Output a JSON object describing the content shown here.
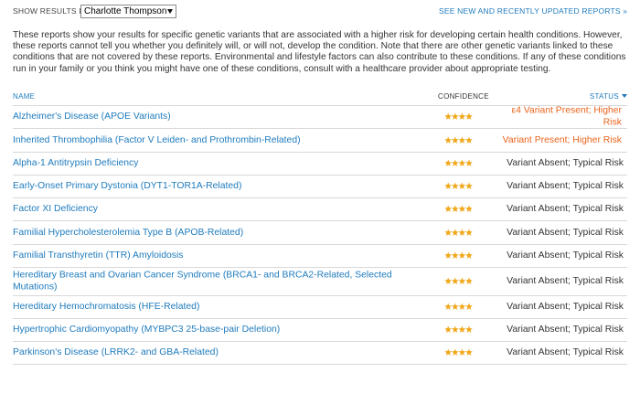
{
  "header": {
    "show_results_label": "SHOW RESULTS FOR",
    "selected_person": "Charlotte Thompson",
    "see_new_link": "SEE NEW AND RECENTLY UPDATED REPORTS",
    "see_new_arrow": "»"
  },
  "intro_text": "These reports show your results for specific genetic variants that are associated with a higher risk for developing certain health conditions. However, these reports cannot tell you whether you definitely will, or will not, develop the condition. Note that there are other genetic variants linked to these conditions that are not covered by these reports. Environmental and lifestyle factors can also contribute to these conditions. If any of these conditions run in your family or you think you might have one of these conditions, consult with a healthcare provider about appropriate testing.",
  "columns": {
    "name": "NAME",
    "confidence": "CONFIDENCE",
    "status": "STATUS"
  },
  "colors": {
    "link": "#1f7bbd",
    "risk": "#e8641c",
    "star": "#f0a81c"
  },
  "rows": [
    {
      "name": "Alzheimer's Disease (APOE Variants)",
      "stars": 4,
      "status": "ε4 Variant Present; Higher Risk",
      "risk": true
    },
    {
      "name": "Inherited Thrombophilia (Factor V Leiden- and Prothrombin-Related)",
      "stars": 4,
      "status": "Variant Present; Higher Risk",
      "risk": true
    },
    {
      "name": "Alpha-1 Antitrypsin Deficiency",
      "stars": 4,
      "status": "Variant Absent; Typical Risk",
      "risk": false
    },
    {
      "name": "Early-Onset Primary Dystonia (DYT1-TOR1A-Related)",
      "stars": 4,
      "status": "Variant Absent; Typical Risk",
      "risk": false
    },
    {
      "name": "Factor XI Deficiency",
      "stars": 4,
      "status": "Variant Absent; Typical Risk",
      "risk": false
    },
    {
      "name": "Familial Hypercholesterolemia Type B (APOB-Related)",
      "stars": 4,
      "status": "Variant Absent; Typical Risk",
      "risk": false
    },
    {
      "name": "Familial Transthyretin (TTR) Amyloidosis",
      "stars": 4,
      "status": "Variant Absent; Typical Risk",
      "risk": false
    },
    {
      "name": "Hereditary Breast and Ovarian Cancer Syndrome (BRCA1- and BRCA2-Related, Selected Mutations)",
      "stars": 4,
      "status": "Variant Absent; Typical Risk",
      "risk": false
    },
    {
      "name": "Hereditary Hemochromatosis (HFE-Related)",
      "stars": 4,
      "status": "Variant Absent; Typical Risk",
      "risk": false
    },
    {
      "name": "Hypertrophic Cardiomyopathy (MYBPC3 25-base-pair Deletion)",
      "stars": 4,
      "status": "Variant Absent; Typical Risk",
      "risk": false
    },
    {
      "name": "Parkinson's Disease (LRRK2- and GBA-Related)",
      "stars": 4,
      "status": "Variant Absent; Typical Risk",
      "risk": false
    }
  ]
}
